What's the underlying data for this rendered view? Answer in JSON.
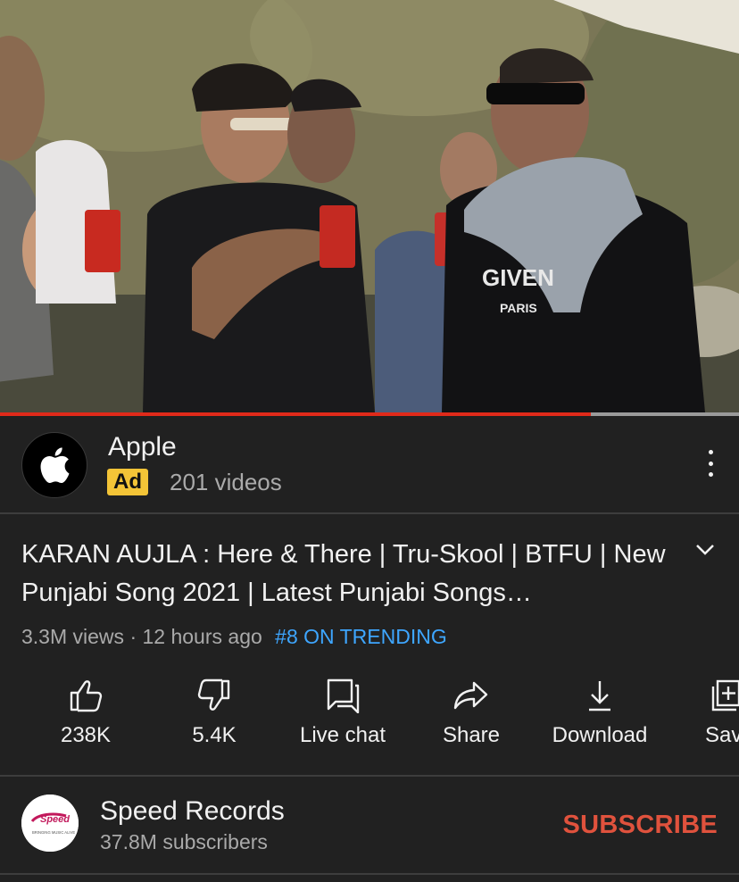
{
  "video": {
    "progress_fraction": 0.8,
    "shirt_text_1": "GIVEN",
    "shirt_text_2": "PARIS"
  },
  "ad": {
    "channel_name": "Apple",
    "badge": "Ad",
    "subtitle": "201 videos",
    "logo_icon": "apple-logo-icon"
  },
  "title": {
    "text": "KARAN AUJLA : Here & There | Tru-Skool | BTFU | New Punjabi Song 2021 | Latest Punjabi Songs…"
  },
  "meta": {
    "views": "3.3M views",
    "separator": "·",
    "age": "12 hours ago",
    "trending": "#8 ON TRENDING"
  },
  "actions": [
    {
      "label": "238K",
      "icon": "thumbs-up-icon"
    },
    {
      "label": "5.4K",
      "icon": "thumbs-down-icon"
    },
    {
      "label": "Live chat",
      "icon": "live-chat-icon"
    },
    {
      "label": "Share",
      "icon": "share-icon"
    },
    {
      "label": "Download",
      "icon": "download-icon"
    },
    {
      "label": "Sav",
      "icon": "save-playlist-icon"
    }
  ],
  "channel": {
    "name": "Speed Records",
    "subscribers": "37.8M subscribers",
    "subscribe_label": "SUBSCRIBE",
    "logo_text": "Speed",
    "logo_tagline": "BRINGING MUSIC ALIVE"
  },
  "colors": {
    "background": "#212121",
    "progress_played": "#e02a1a",
    "trending": "#3ea6ff",
    "subscribe": "#e0523d",
    "ad_badge": "#f3c437"
  }
}
